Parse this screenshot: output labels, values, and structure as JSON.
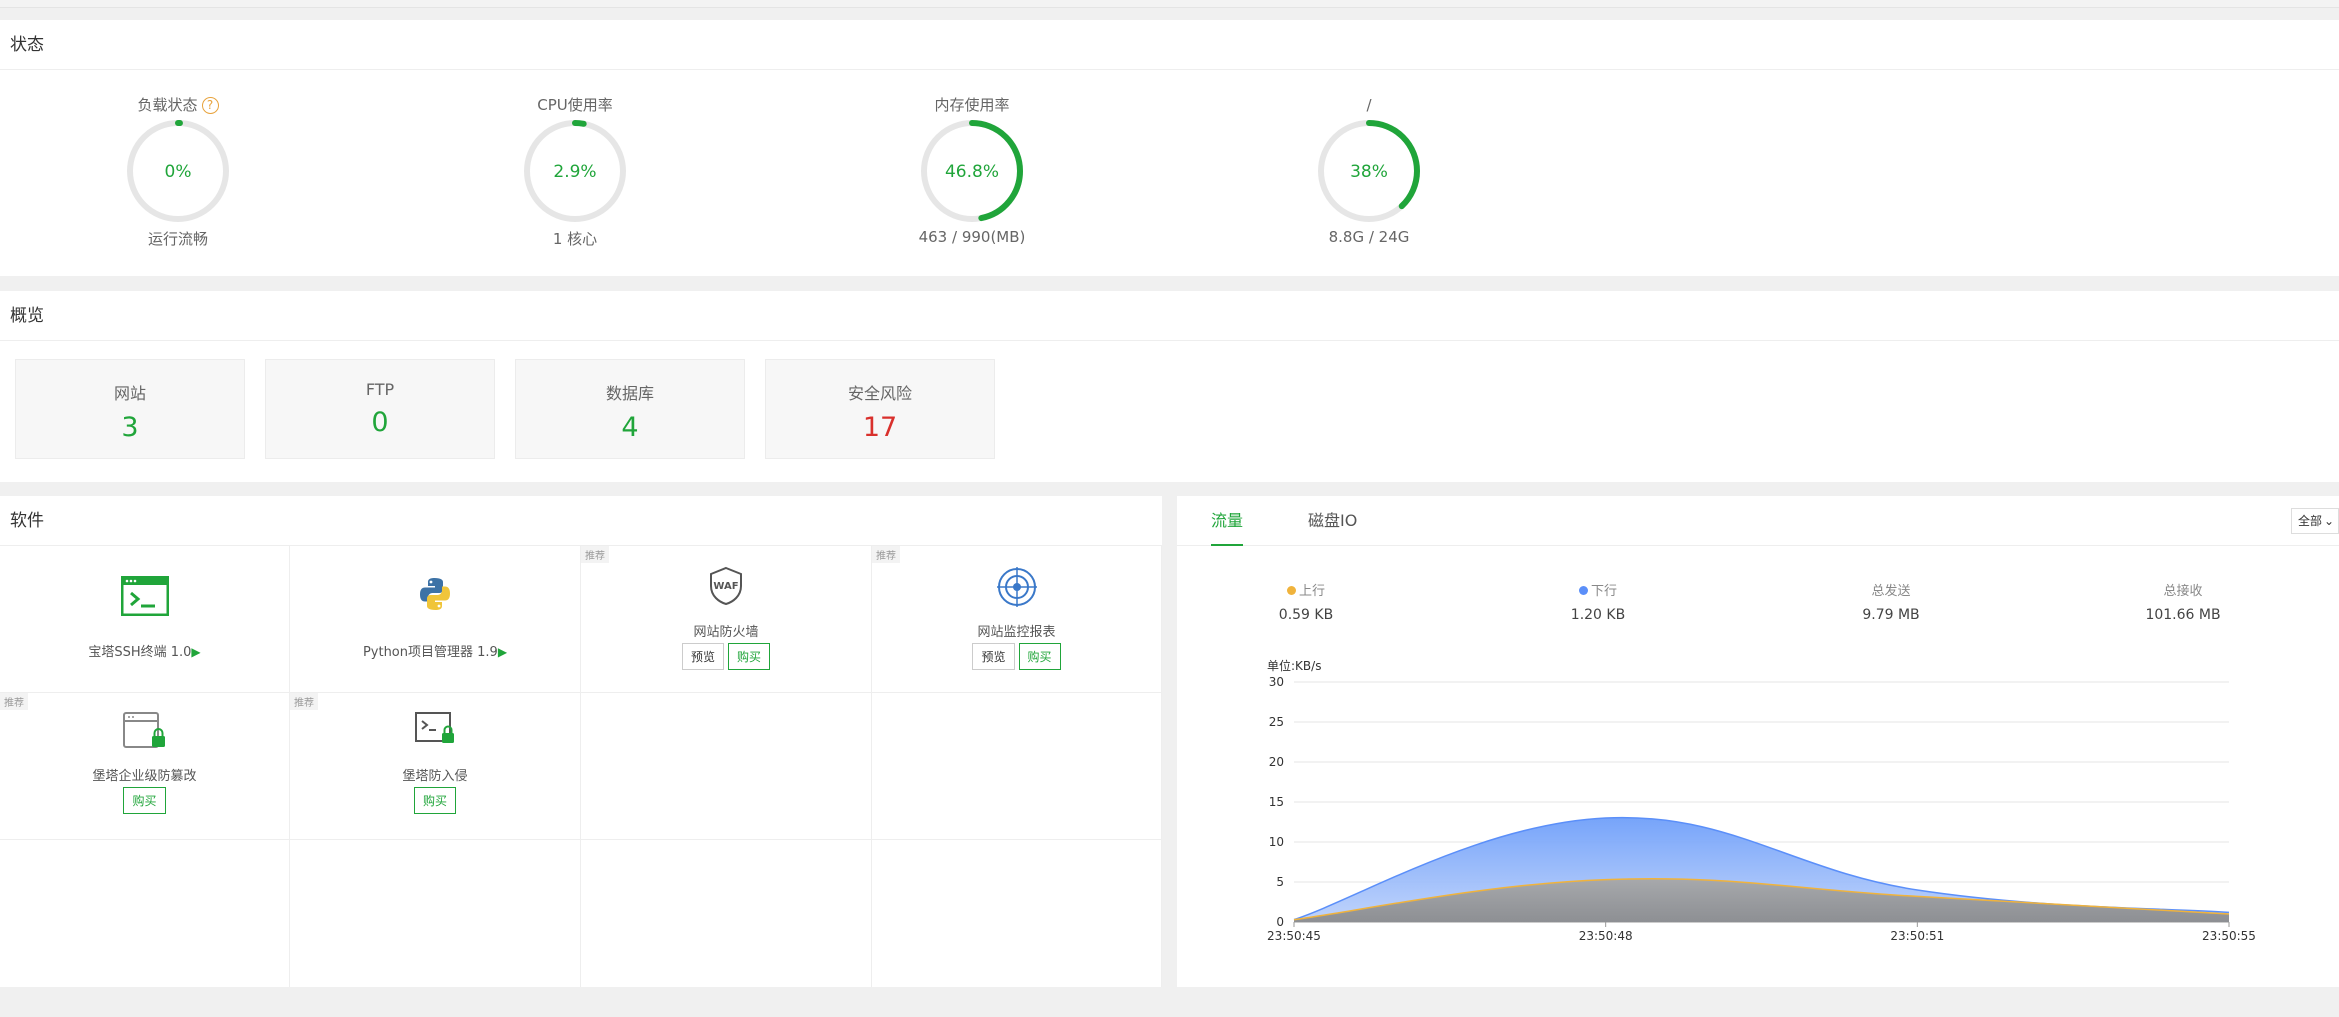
{
  "status": {
    "title": "状态",
    "gauges": [
      {
        "title": "负载状态",
        "value_text": "0%",
        "percent": 0,
        "sub": "运行流畅",
        "has_help": true
      },
      {
        "title": "CPU使用率",
        "value_text": "2.9%",
        "percent": 2.9,
        "sub": "1 核心",
        "has_help": false
      },
      {
        "title": "内存使用率",
        "value_text": "46.8%",
        "percent": 46.8,
        "sub": "463 / 990(MB)",
        "has_help": false
      },
      {
        "title": "/",
        "value_text": "38%",
        "percent": 38,
        "sub": "8.8G / 24G",
        "has_help": false
      }
    ],
    "help_glyph": "?"
  },
  "overview": {
    "title": "概览",
    "cards": [
      {
        "label": "网站",
        "value": "3",
        "color": "#20a53a"
      },
      {
        "label": "FTP",
        "value": "0",
        "color": "#20a53a"
      },
      {
        "label": "数据库",
        "value": "4",
        "color": "#20a53a"
      },
      {
        "label": "安全风险",
        "value": "17",
        "color": "#d9302c"
      }
    ]
  },
  "software": {
    "title": "软件",
    "items": [
      {
        "name": "宝塔SSH终端 1.0",
        "icon": "terminal-icon",
        "recommended": false,
        "buttons": [],
        "play": true
      },
      {
        "name": "Python项目管理器 1.9",
        "icon": "python-icon",
        "recommended": false,
        "buttons": [],
        "play": true
      },
      {
        "name": "网站防火墙",
        "icon": "waf-shield-icon",
        "recommended": true,
        "buttons": [
          "预览",
          "购买"
        ],
        "play": false
      },
      {
        "name": "网站监控报表",
        "icon": "monitor-target-icon",
        "recommended": true,
        "buttons": [
          "预览",
          "购买"
        ],
        "play": false
      },
      {
        "name": "堡塔企业级防篡改",
        "icon": "tamper-lock-icon",
        "recommended": true,
        "buttons": [
          "购买"
        ],
        "play": false
      },
      {
        "name": "堡塔防入侵",
        "icon": "intrusion-lock-icon",
        "recommended": true,
        "buttons": [
          "购买"
        ],
        "play": false
      }
    ],
    "rec_label": "推荐",
    "play_glyph": "▶"
  },
  "traffic": {
    "tabs": [
      "流量",
      "磁盘IO"
    ],
    "active_tab": 0,
    "select_value": "全部",
    "stats": [
      {
        "label": "上行",
        "value": "0.59 KB",
        "dot": "#f0b33c"
      },
      {
        "label": "下行",
        "value": "1.20 KB",
        "dot": "#5b8ff9"
      },
      {
        "label": "总发送",
        "value": "9.79 MB",
        "dot": ""
      },
      {
        "label": "总接收",
        "value": "101.66 MB",
        "dot": ""
      }
    ]
  },
  "chart_data": {
    "type": "area",
    "ylabel": "单位:KB/s",
    "ylim": [
      0,
      30
    ],
    "yticks": [
      0,
      5,
      10,
      15,
      20,
      25,
      30
    ],
    "x": [
      "23:50:45",
      "23:50:48",
      "23:50:51",
      "23:50:55"
    ],
    "series": [
      {
        "name": "上行",
        "color": "#f0b33c",
        "values": [
          0.3,
          5.3,
          3.2,
          1.0
        ]
      },
      {
        "name": "下行",
        "color": "#5b8ff9",
        "values": [
          0.3,
          13.0,
          4.0,
          1.2
        ]
      }
    ],
    "grid": true
  },
  "colors": {
    "accent": "#20a53a",
    "danger": "#d9302c",
    "gauge_track": "#e6e6e6"
  }
}
